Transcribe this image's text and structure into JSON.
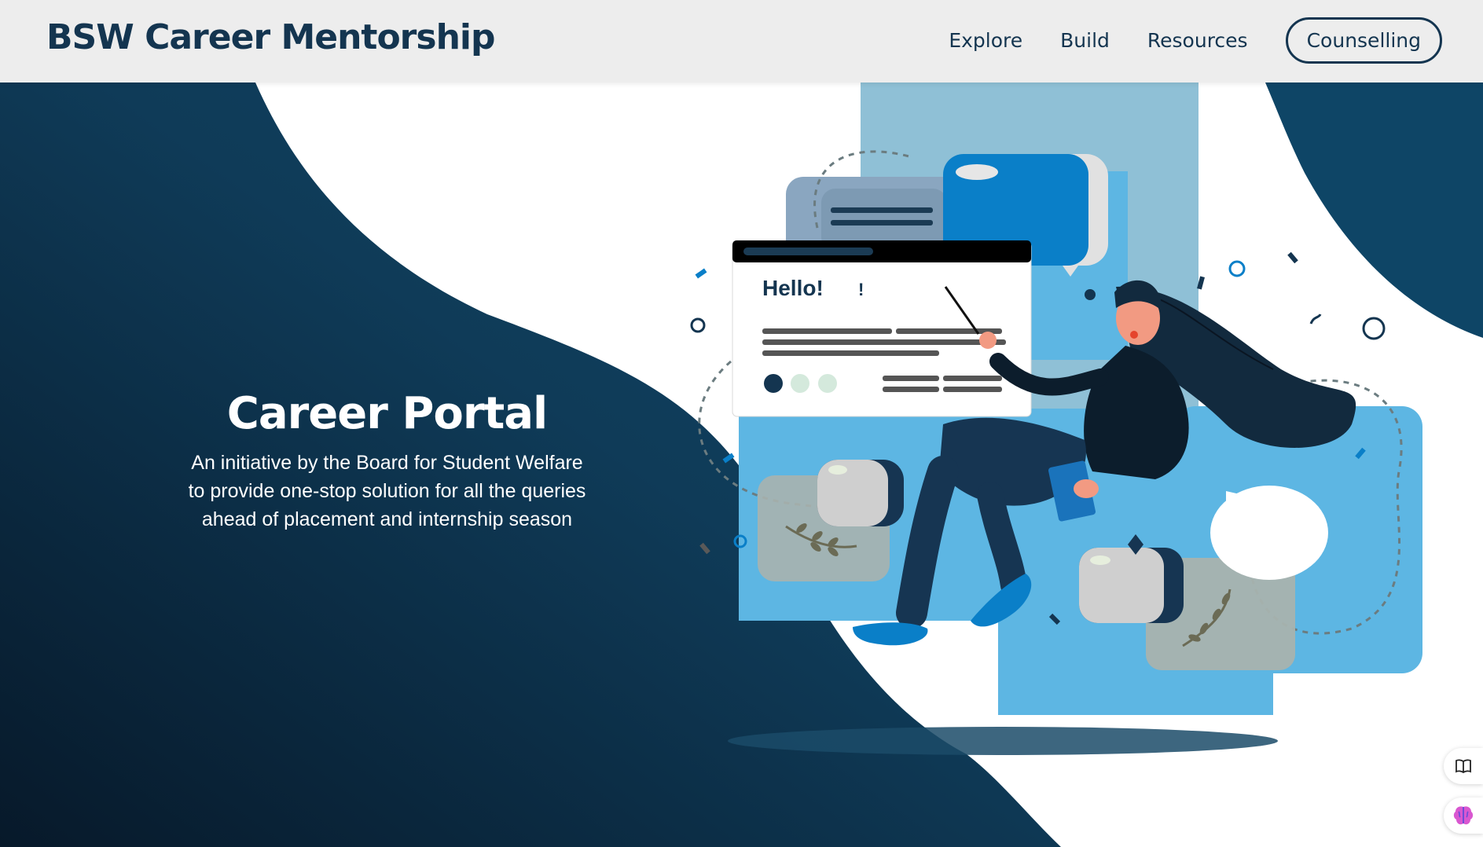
{
  "brand": {
    "name": "BSW Career Mentorship"
  },
  "nav": {
    "links": [
      "Explore",
      "Build",
      "Resources"
    ],
    "cta": "Counselling"
  },
  "hero": {
    "title": "Career Portal",
    "subtitle_lines": [
      "An initiative by the Board for Student Welfare",
      "to provide one-stop solution for all the queries",
      "ahead of placement and internship season"
    ]
  },
  "illustration": {
    "greeting": "Hello!",
    "exclaim": "!"
  },
  "floating": {
    "icons": [
      "book-icon",
      "brain-icon"
    ]
  },
  "colors": {
    "navy": "#143550",
    "navbar": "#ededed",
    "accent_blue": "#0a7fc8",
    "light_blue": "#5db6e3"
  }
}
